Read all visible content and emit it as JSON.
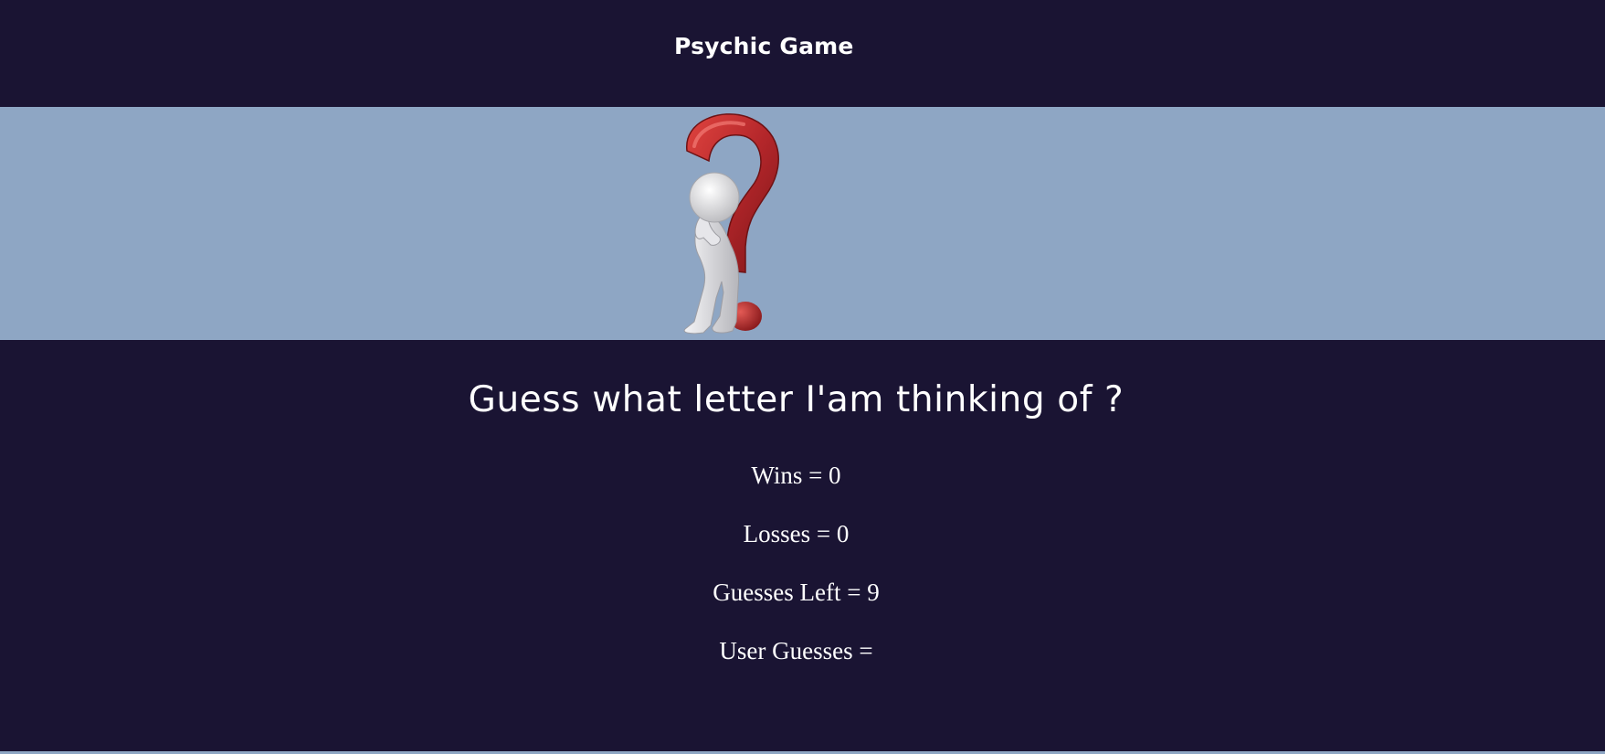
{
  "header": {
    "title": "Psychic Game"
  },
  "banner": {
    "image_icon": "thinking-figure-question-mark-icon"
  },
  "main": {
    "question": "Guess what letter I'am thinking of ?",
    "stats": {
      "wins": "Wins = 0",
      "losses": "Losses = 0",
      "guesses_left": "Guesses Left = 9",
      "user_guesses": "User Guesses ="
    }
  },
  "colors": {
    "background_dark": "#1a1433",
    "banner_blue": "#8ea6c4",
    "text": "#ffffff",
    "question_mark_red": "#b3262a"
  }
}
